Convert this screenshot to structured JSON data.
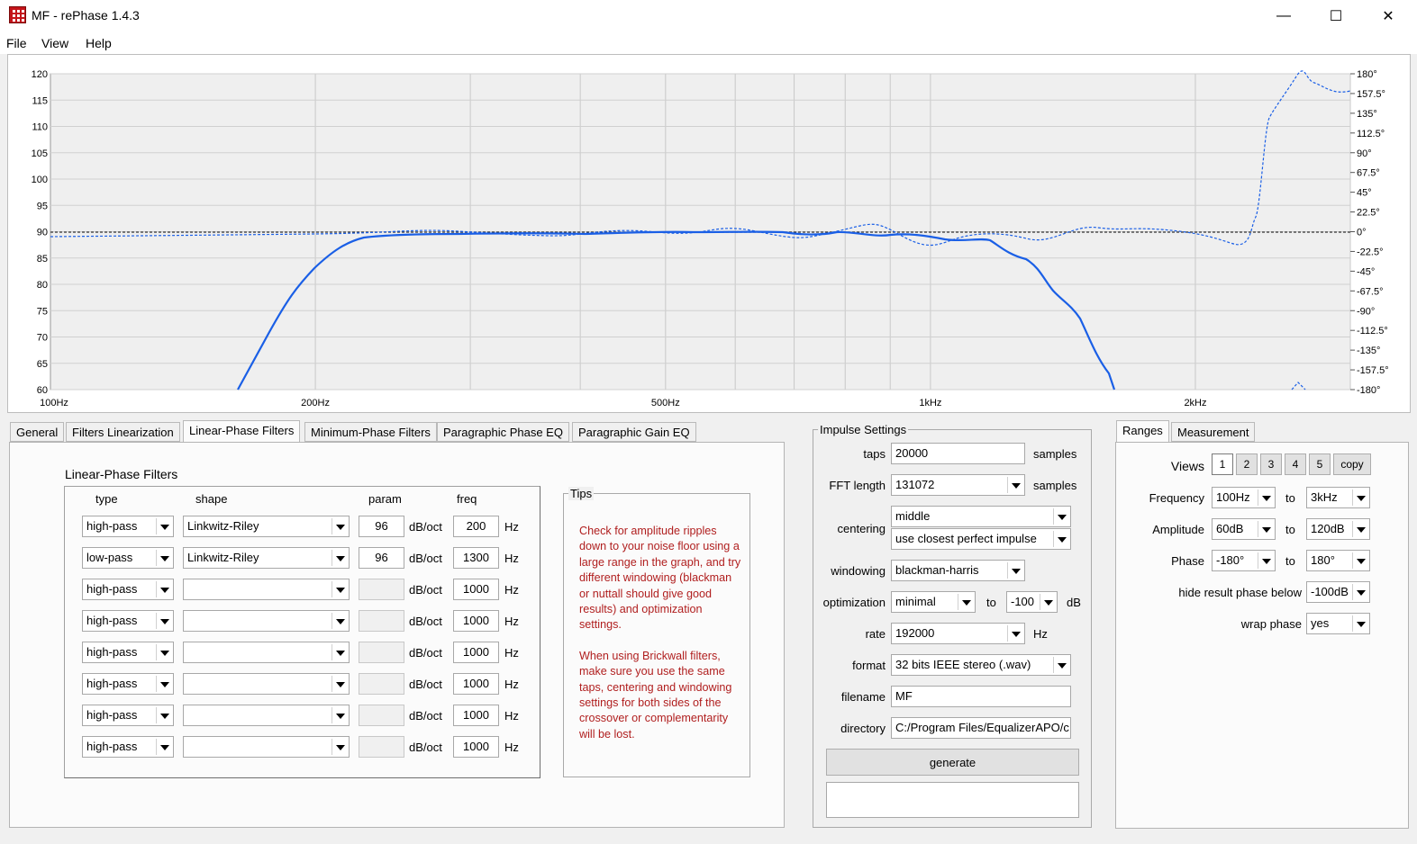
{
  "window": {
    "title": "MF  -  rePhase 1.4.3",
    "controls": {
      "minimize": "—",
      "maximize": "☐",
      "close": "✕"
    }
  },
  "menu": [
    "File",
    "View",
    "Help"
  ],
  "graph": {
    "left_axis_ticks": [
      "120",
      "115",
      "110",
      "105",
      "100",
      "95",
      "90",
      "85",
      "80",
      "75",
      "70",
      "65",
      "60"
    ],
    "right_axis_ticks": [
      "180°",
      "157.5°",
      "135°",
      "112.5°",
      "90°",
      "67.5°",
      "45°",
      "22.5°",
      "0°",
      "-22.5°",
      "-45°",
      "-67.5°",
      "-90°",
      "-112.5°",
      "-135°",
      "-157.5°",
      "-180°"
    ],
    "x_ticks": [
      "100Hz",
      "200Hz",
      "500Hz",
      "1kHz",
      "2kHz"
    ],
    "colors": {
      "curve": "#1a5fe6",
      "grid": "#c8c8c8",
      "zero_line": "#333333"
    }
  },
  "tabs": [
    "General",
    "Filters Linearization",
    "Linear-Phase Filters",
    "Minimum-Phase Filters",
    "Paragraphic Phase EQ",
    "Paragraphic Gain EQ"
  ],
  "active_tab": "Linear-Phase Filters",
  "lpf": {
    "title": "Linear-Phase Filters",
    "headers": {
      "type": "type",
      "shape": "shape",
      "param": "param",
      "freq": "freq"
    },
    "units": {
      "slope": "dB/oct",
      "hz": "Hz"
    },
    "rows": [
      {
        "type": "high-pass",
        "shape": "Linkwitz-Riley",
        "param": "96",
        "freq": "200"
      },
      {
        "type": "low-pass",
        "shape": "Linkwitz-Riley",
        "param": "96",
        "freq": "1300"
      },
      {
        "type": "high-pass",
        "shape": "",
        "param": "",
        "freq": "1000"
      },
      {
        "type": "high-pass",
        "shape": "",
        "param": "",
        "freq": "1000"
      },
      {
        "type": "high-pass",
        "shape": "",
        "param": "",
        "freq": "1000"
      },
      {
        "type": "high-pass",
        "shape": "",
        "param": "",
        "freq": "1000"
      },
      {
        "type": "high-pass",
        "shape": "",
        "param": "",
        "freq": "1000"
      },
      {
        "type": "high-pass",
        "shape": "",
        "param": "",
        "freq": "1000"
      }
    ]
  },
  "tips": {
    "title": "Tips",
    "p1": "Check for amplitude ripples down to your noise floor using a large range in the graph, and try different windowing (blackman or nuttall should give good results) and optimization settings.",
    "p2": "When using Brickwall filters, make sure you use the same taps, centering and windowing settings for both sides of the crossover or complementarity will be lost."
  },
  "impulse": {
    "title": "Impulse Settings",
    "taps_label": "taps",
    "taps": "20000",
    "samples": "samples",
    "fft_label": "FFT length",
    "fft": "131072",
    "centering_label": "centering",
    "centering": "middle",
    "centering2": "use closest perfect impulse",
    "windowing_label": "windowing",
    "windowing": "blackman-harris",
    "optimization_label": "optimization",
    "optimization": "minimal",
    "to": "to",
    "opt_db": "-100",
    "db": "dB",
    "rate_label": "rate",
    "rate": "192000",
    "hz": "Hz",
    "format_label": "format",
    "format": "32 bits IEEE stereo (.wav)",
    "filename_label": "filename",
    "filename": "MF",
    "directory_label": "directory",
    "directory": "C:/Program Files/EqualizerAPO/c",
    "generate": "generate"
  },
  "ranges": {
    "tabs": [
      "Ranges",
      "Measurement"
    ],
    "views_label": "Views",
    "views": [
      "1",
      "2",
      "3",
      "4",
      "5"
    ],
    "copy": "copy",
    "frequency_label": "Frequency",
    "freq_from": "100Hz",
    "freq_to": "3kHz",
    "amplitude_label": "Amplitude",
    "amp_from": "60dB",
    "amp_to": "120dB",
    "phase_label": "Phase",
    "phase_from": "-180°",
    "phase_to": "180°",
    "to": "to",
    "hide_label": "hide result phase below",
    "hide": "-100dB",
    "wrap_label": "wrap phase",
    "wrap": "yes"
  }
}
